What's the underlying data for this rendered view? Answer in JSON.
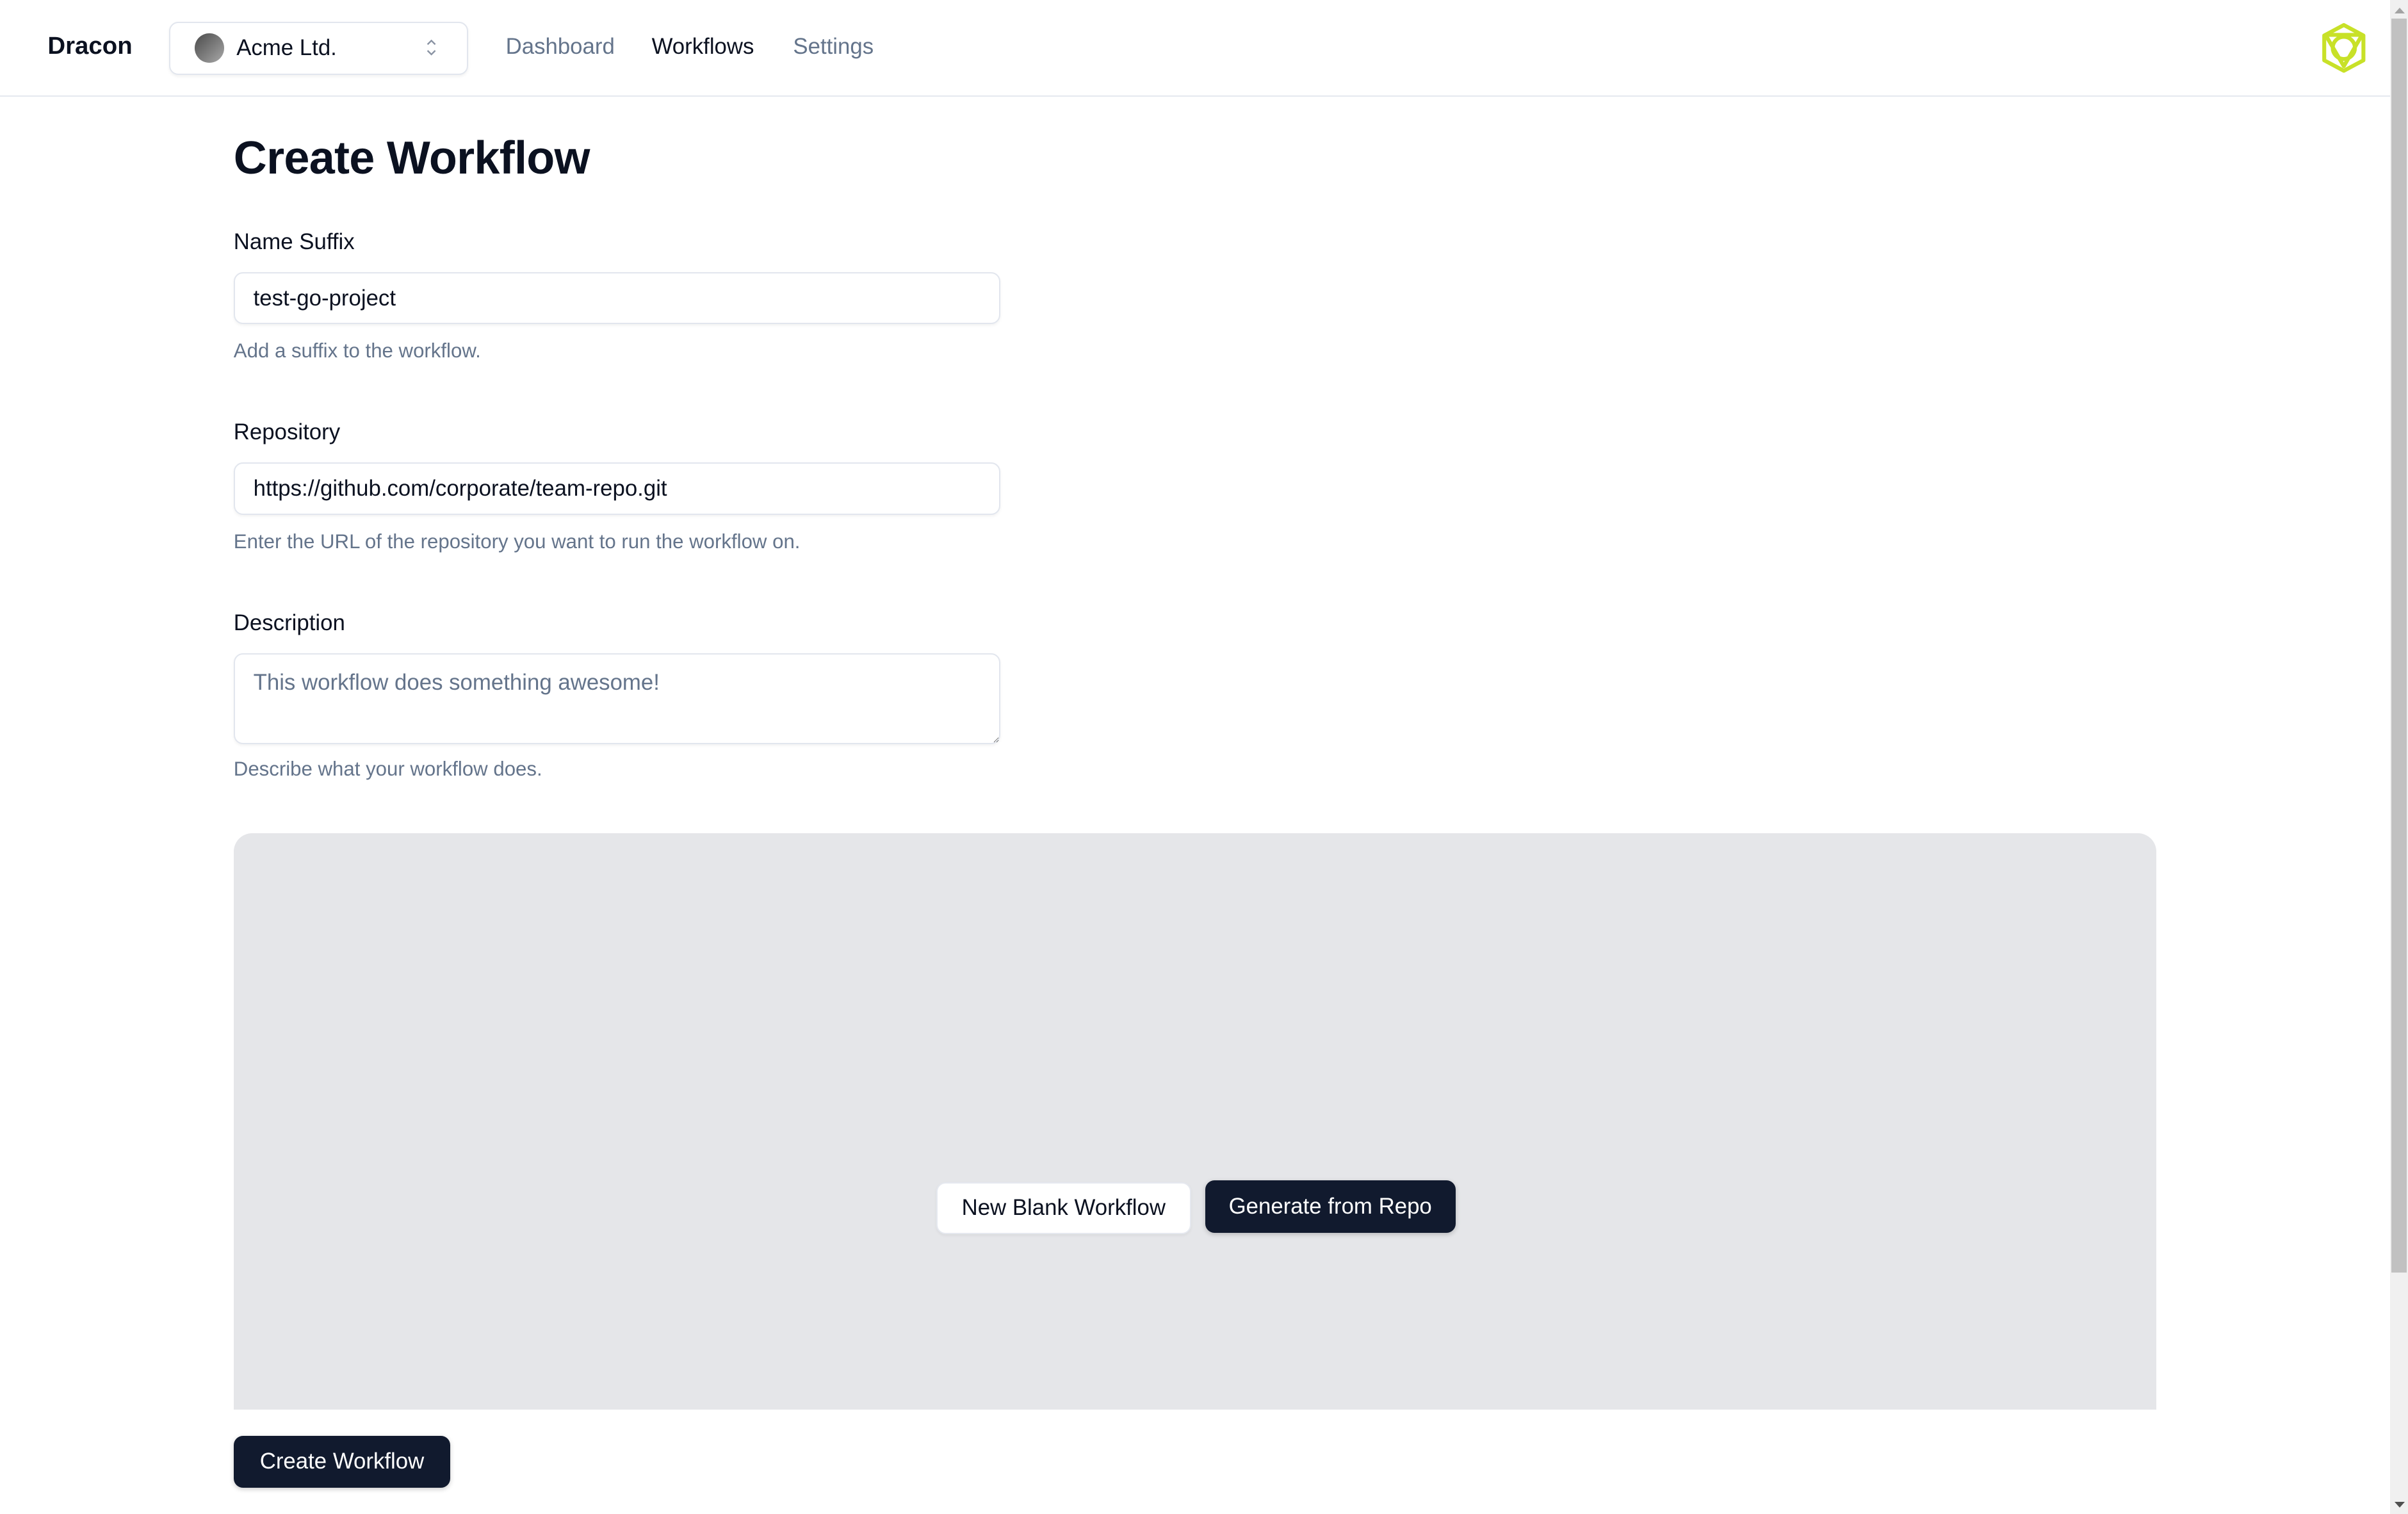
{
  "header": {
    "brand": "Dracon",
    "org_switcher": {
      "selected": "Acme Ltd.",
      "icon": "chevron-up-down-icon"
    },
    "nav": [
      {
        "label": "Dashboard",
        "active": false
      },
      {
        "label": "Workflows",
        "active": true
      },
      {
        "label": "Settings",
        "active": false
      }
    ],
    "logo_icon": "hexagon-logo-icon",
    "logo_color": "#c8e128"
  },
  "page": {
    "title": "Create Workflow",
    "fields": {
      "name_suffix": {
        "label": "Name Suffix",
        "value": "test-go-project",
        "helper": "Add a suffix to the workflow."
      },
      "repository": {
        "label": "Repository",
        "value": "https://github.com/corporate/team-repo.git",
        "helper": "Enter the URL of the repository you want to run the workflow on."
      },
      "description": {
        "label": "Description",
        "value": "",
        "placeholder": "This workflow does something awesome!",
        "helper": "Describe what your workflow does."
      }
    },
    "canvas": {
      "new_blank_label": "New Blank Workflow",
      "generate_label": "Generate from Repo"
    },
    "submit_label": "Create Workflow"
  },
  "colors": {
    "primary_dark": "#111a2e",
    "muted_text": "#64748b",
    "canvas_bg": "#e5e6e9"
  }
}
